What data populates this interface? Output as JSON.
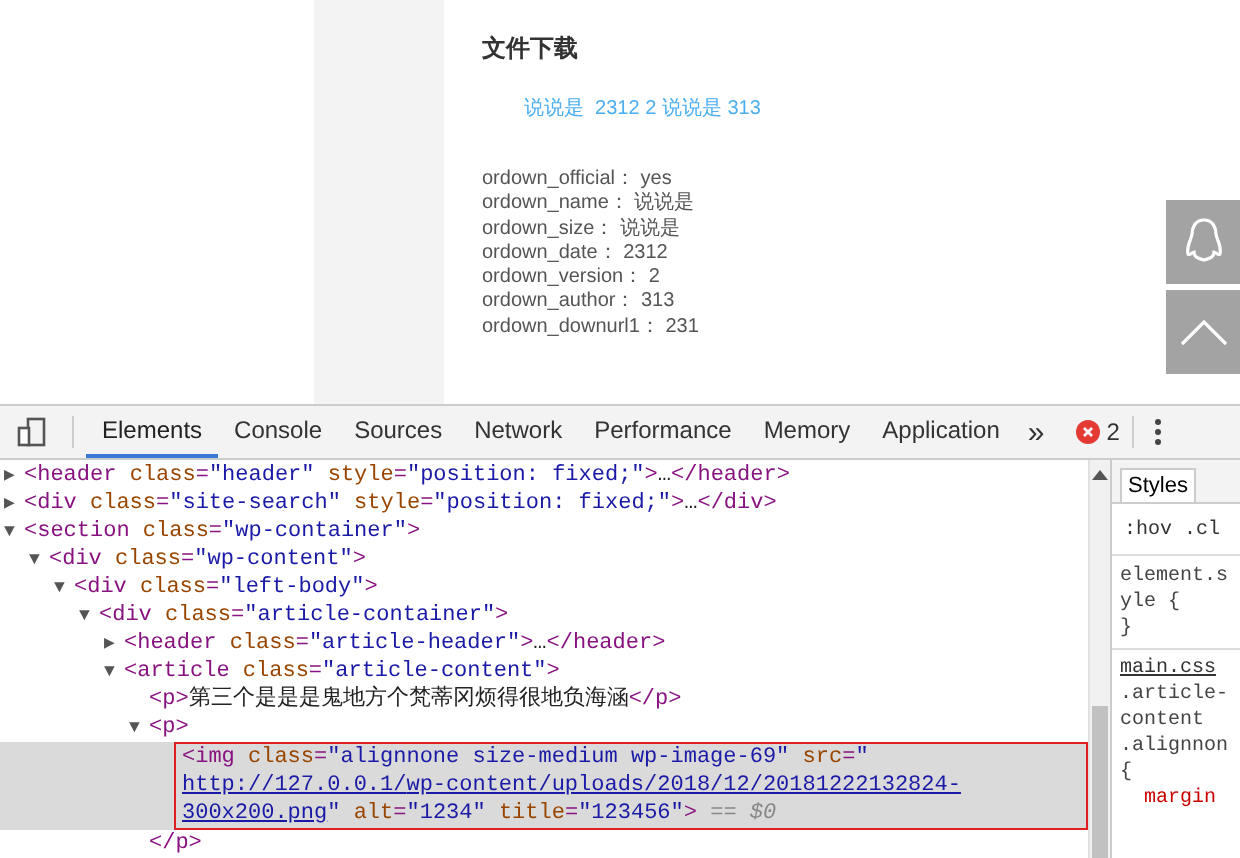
{
  "page": {
    "heading": "文件下载",
    "link": "说说是  2312 2 说说是 313",
    "fields": [
      "ordown_official： yes",
      "ordown_name： 说说是",
      "ordown_size： 说说是",
      "ordown_date： 2312",
      "ordown_version： 2",
      "ordown_author： 313",
      "ordown_downurl1： 231"
    ]
  },
  "devtools": {
    "tabs": [
      {
        "label": "Elements",
        "selected": true
      },
      {
        "label": "Console",
        "selected": false
      },
      {
        "label": "Sources",
        "selected": false
      },
      {
        "label": "Network",
        "selected": false
      },
      {
        "label": "Performance",
        "selected": false
      },
      {
        "label": "Memory",
        "selected": false
      },
      {
        "label": "Application",
        "selected": false
      }
    ],
    "overflow": "»",
    "error_count": "2",
    "dom": [
      {
        "toggle": "▶",
        "selected": false,
        "tokens": [
          {
            "kind": "tag",
            "text": "<header"
          },
          {
            "kind": "attr",
            "text": " class"
          },
          {
            "kind": "tag",
            "text": "="
          },
          {
            "kind": "value",
            "text": "\"header\""
          },
          {
            "kind": "attr",
            "text": " style"
          },
          {
            "kind": "tag",
            "text": "="
          },
          {
            "kind": "value",
            "text": "\"position: fixed;\""
          },
          {
            "kind": "tag",
            "text": ">"
          },
          {
            "kind": "plain",
            "text": "…"
          },
          {
            "kind": "tag",
            "text": "</header>"
          }
        ]
      },
      {
        "toggle": "▶",
        "selected": false,
        "tokens": [
          {
            "kind": "tag",
            "text": "<div"
          },
          {
            "kind": "attr",
            "text": " class"
          },
          {
            "kind": "tag",
            "text": "="
          },
          {
            "kind": "value",
            "text": "\"site-search\""
          },
          {
            "kind": "attr",
            "text": " style"
          },
          {
            "kind": "tag",
            "text": "="
          },
          {
            "kind": "value",
            "text": "\"position: fixed;\""
          },
          {
            "kind": "tag",
            "text": ">"
          },
          {
            "kind": "plain",
            "text": "…"
          },
          {
            "kind": "tag",
            "text": "</div>"
          }
        ]
      },
      {
        "toggle": "▼",
        "selected": false,
        "tokens": [
          {
            "kind": "tag",
            "text": "<section"
          },
          {
            "kind": "attr",
            "text": " class"
          },
          {
            "kind": "tag",
            "text": "="
          },
          {
            "kind": "value",
            "text": "\"wp-container\""
          },
          {
            "kind": "tag",
            "text": ">"
          }
        ],
        "children": [
          {
            "toggle": "▼",
            "selected": false,
            "tokens": [
              {
                "kind": "tag",
                "text": "<div"
              },
              {
                "kind": "attr",
                "text": " class"
              },
              {
                "kind": "tag",
                "text": "="
              },
              {
                "kind": "value",
                "text": "\"wp-content\""
              },
              {
                "kind": "tag",
                "text": ">"
              }
            ],
            "children": [
              {
                "toggle": "▼",
                "selected": false,
                "tokens": [
                  {
                    "kind": "tag",
                    "text": "<div"
                  },
                  {
                    "kind": "attr",
                    "text": " class"
                  },
                  {
                    "kind": "tag",
                    "text": "="
                  },
                  {
                    "kind": "value",
                    "text": "\"left-body\""
                  },
                  {
                    "kind": "tag",
                    "text": ">"
                  }
                ],
                "children": [
                  {
                    "toggle": "▼",
                    "selected": false,
                    "tokens": [
                      {
                        "kind": "tag",
                        "text": "<div"
                      },
                      {
                        "kind": "attr",
                        "text": " class"
                      },
                      {
                        "kind": "tag",
                        "text": "="
                      },
                      {
                        "kind": "value",
                        "text": "\"article-container\""
                      },
                      {
                        "kind": "tag",
                        "text": ">"
                      }
                    ],
                    "children": [
                      {
                        "toggle": "▶",
                        "selected": false,
                        "tokens": [
                          {
                            "kind": "tag",
                            "text": "<header"
                          },
                          {
                            "kind": "attr",
                            "text": " class"
                          },
                          {
                            "kind": "tag",
                            "text": "="
                          },
                          {
                            "kind": "value",
                            "text": "\"article-header\""
                          },
                          {
                            "kind": "tag",
                            "text": ">"
                          },
                          {
                            "kind": "plain",
                            "text": "…"
                          },
                          {
                            "kind": "tag",
                            "text": "</header>"
                          }
                        ]
                      },
                      {
                        "toggle": "▼",
                        "selected": false,
                        "tokens": [
                          {
                            "kind": "tag",
                            "text": "<article"
                          },
                          {
                            "kind": "attr",
                            "text": " class"
                          },
                          {
                            "kind": "tag",
                            "text": "="
                          },
                          {
                            "kind": "value",
                            "text": "\"article-content\""
                          },
                          {
                            "kind": "tag",
                            "text": ">"
                          }
                        ],
                        "children": [
                          {
                            "selected": false,
                            "tokens": [
                              {
                                "kind": "tag",
                                "text": "<p>"
                              },
                              {
                                "kind": "plain",
                                "text": "第三个是是是鬼地方个梵蒂冈烦得很地负海涵"
                              },
                              {
                                "kind": "tag",
                                "text": "</p>"
                              }
                            ]
                          },
                          {
                            "toggle": "▼",
                            "selected": false,
                            "tokens": [
                              {
                                "kind": "tag",
                                "text": "<p>"
                              }
                            ],
                            "children": [
                              {
                                "selected": true,
                                "tokens": [
                                  {
                                    "kind": "tag",
                                    "text": "<img"
                                  },
                                  {
                                    "kind": "attr",
                                    "text": " class"
                                  },
                                  {
                                    "kind": "tag",
                                    "text": "="
                                  },
                                  {
                                    "kind": "value",
                                    "text": "\"alignnone size-medium wp-image-69\""
                                  },
                                  {
                                    "kind": "attr",
                                    "text": " src"
                                  },
                                  {
                                    "kind": "tag",
                                    "text": "="
                                  },
                                  {
                                    "kind": "value",
                                    "text": "\""
                                  },
                                  {
                                    "kind": "link",
                                    "text": "http://127.0.0.1/"
                                  },
                                  {
                                    "kind": "link",
                                    "text": "wp-content/uploads/2018/12/20181222132824-300x200.png"
                                  },
                                  {
                                    "kind": "value",
                                    "text": "\""
                                  },
                                  {
                                    "kind": "attr",
                                    "text": " alt"
                                  },
                                  {
                                    "kind": "tag",
                                    "text": "="
                                  },
                                  {
                                    "kind": "value",
                                    "text": "\"1234\""
                                  },
                                  {
                                    "kind": "attr",
                                    "text": " title"
                                  },
                                  {
                                    "kind": "tag",
                                    "text": "="
                                  },
                                  {
                                    "kind": "value",
                                    "text": "\"123456\""
                                  },
                                  {
                                    "kind": "tag",
                                    "text": ">"
                                  },
                                  {
                                    "kind": "ref",
                                    "text": " == $0"
                                  }
                                ]
                              }
                            ]
                          },
                          {
                            "selected": false,
                            "tokens": [
                              {
                                "kind": "tag",
                                "text": "</p>"
                              }
                            ]
                          }
                        ]
                      }
                    ]
                  }
                ]
              }
            ]
          }
        ]
      }
    ],
    "styles": {
      "tab": "Styles",
      "filter": ":hov .cl",
      "rules": [
        {
          "kind": "plain",
          "text": "element.s"
        },
        {
          "kind": "plain",
          "text": "yle {"
        },
        {
          "kind": "plain",
          "text": "}"
        },
        {
          "kind": "source",
          "text": "main.css"
        },
        {
          "kind": "plain",
          "text": ".article-"
        },
        {
          "kind": "plain",
          "text": "content"
        },
        {
          "kind": "plain",
          "text": ".alignnon"
        },
        {
          "kind": "plain",
          "text": "{"
        },
        {
          "kind": "property",
          "text": "margin"
        }
      ]
    }
  }
}
